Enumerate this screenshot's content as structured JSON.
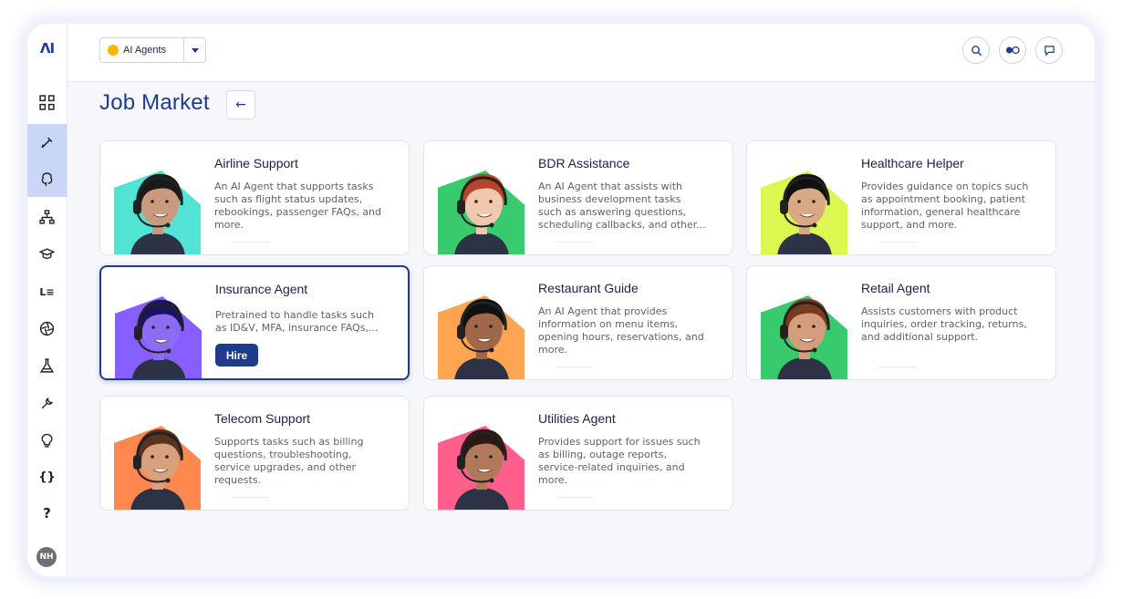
{
  "app": {
    "logo": "ΛI"
  },
  "header": {
    "agent_selector": "AI Agents"
  },
  "page": {
    "title": "Job Market",
    "back_icon": "←"
  },
  "sidebar": {
    "items": [
      {
        "name": "grid-icon"
      },
      {
        "name": "pen-icon",
        "active": true
      },
      {
        "name": "brain-icon",
        "active": true
      },
      {
        "name": "hierarchy-icon"
      },
      {
        "name": "graduation-cap-icon"
      },
      {
        "name": "list-icon"
      },
      {
        "name": "aperture-icon"
      },
      {
        "name": "flask-icon"
      },
      {
        "name": "wrench-icon"
      },
      {
        "name": "lightbulb-icon"
      },
      {
        "name": "braces-icon"
      }
    ],
    "braces_label": "{}",
    "list_label": "L≡",
    "help": "?",
    "avatar_initials": "NH"
  },
  "cards": [
    {
      "title": "Airline Support",
      "description": "An AI Agent that supports tasks such as flight status updates, rebookings, passenger FAQs, and more.",
      "accent": "#3fe0d0",
      "hair": "#1a1a1a",
      "skin": "#c99a7d"
    },
    {
      "title": "BDR Assistance",
      "description": "An AI Agent that assists with business development tasks such as answering questions, scheduling callbacks, and other...",
      "accent": "#22c55e",
      "hair": "#b8432a",
      "skin": "#f0c8ae"
    },
    {
      "title": "Healthcare Helper",
      "description": "Provides guidance on topics such as appointment booking, patient information, general healthcare support, and more.",
      "accent": "#d9f53c",
      "hair": "#111111",
      "skin": "#d9a983"
    },
    {
      "title": "Insurance Agent",
      "description": "Pretrained to handle tasks such as ID&V, MFA, insurance FAQs,...",
      "accent": "#7b4dff",
      "hair": "#1b1464",
      "skin": "#8c6cf0",
      "hire_label": "Hire"
    },
    {
      "title": "Restaurant Guide",
      "description": "An AI Agent that provides information on menu items, opening hours, reservations, and more.",
      "accent": "#ff9a3c",
      "hair": "#111111",
      "skin": "#a0674a"
    },
    {
      "title": "Retail Agent",
      "description": "Assists customers with product inquiries, order tracking, returns, and additional support.",
      "accent": "#22c55e",
      "hair": "#7a3b1c",
      "skin": "#d79c7c"
    },
    {
      "title": "Telecom Support",
      "description": "Supports tasks such as billing questions, troubleshooting, service upgrades, and other requests.",
      "accent": "#ff7a3c",
      "hair": "#5a3320",
      "skin": "#d9a07e"
    },
    {
      "title": "Utilities Agent",
      "description": "Provides support for issues such as billing, outage reports, service-related inquiries, and more.",
      "accent": "#ff4d7d",
      "hair": "#2a1a12",
      "skin": "#b07a5a"
    }
  ]
}
